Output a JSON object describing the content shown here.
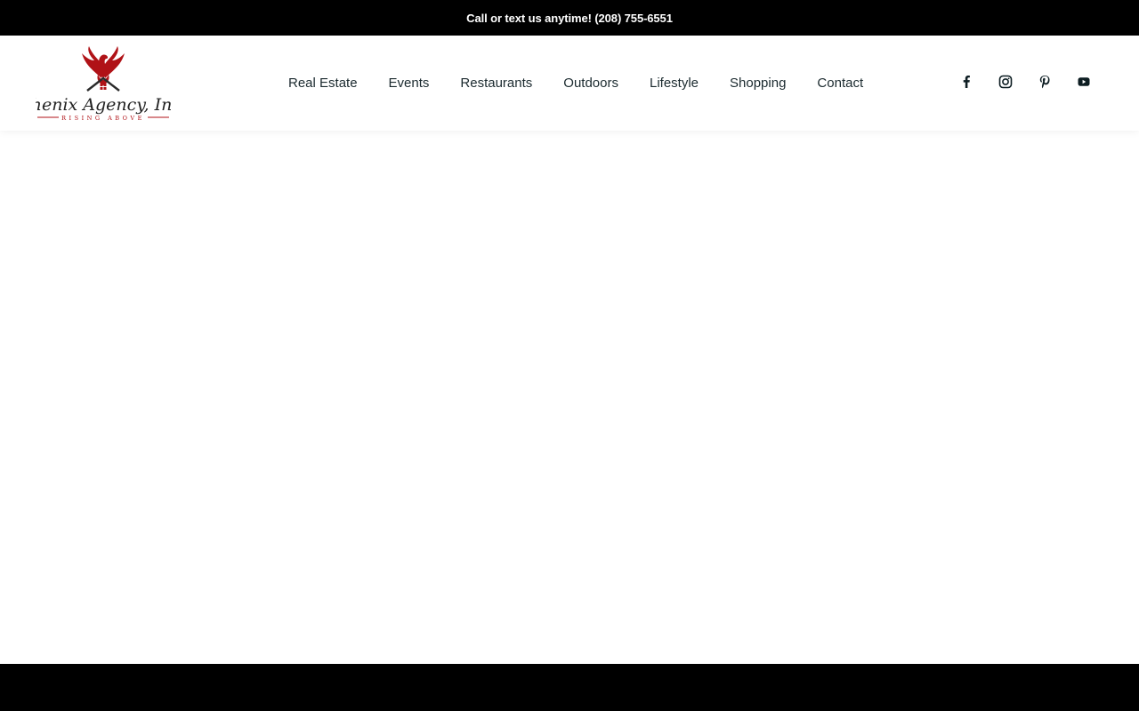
{
  "topbar": {
    "text": "Call or text us anytime! (208) 755-6551"
  },
  "logo": {
    "name": "Phenix Agency, Inc.",
    "tagline": "RISING ABOVE",
    "brand_color": "#b01217",
    "text_color": "#222222"
  },
  "nav": {
    "items": [
      {
        "label": "Real Estate"
      },
      {
        "label": "Events"
      },
      {
        "label": "Restaurants"
      },
      {
        "label": "Outdoors"
      },
      {
        "label": "Lifestyle"
      },
      {
        "label": "Shopping"
      },
      {
        "label": "Contact"
      }
    ]
  },
  "social": {
    "icons": [
      "facebook-icon",
      "instagram-icon",
      "pinterest-icon",
      "youtube-icon"
    ],
    "icon_color": "#0d1d22"
  },
  "colors": {
    "bar_background": "#000000",
    "page_background": "#ffffff",
    "nav_text": "#1b2a2f"
  }
}
